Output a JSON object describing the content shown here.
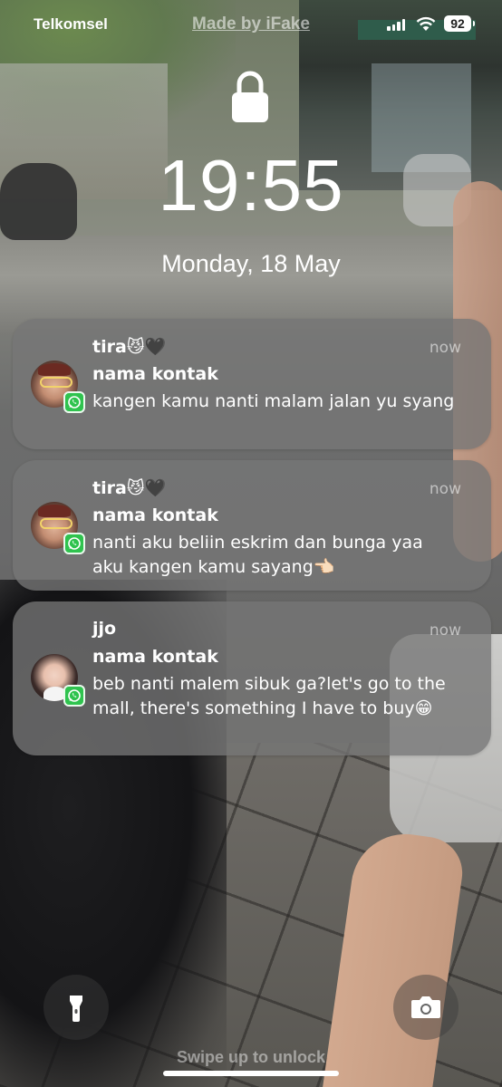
{
  "status_bar": {
    "carrier": "Telkomsel",
    "watermark": "Made by iFake",
    "battery": "92"
  },
  "lock_screen": {
    "time": "19:55",
    "date": "Monday, 18 May",
    "swipe_hint": "Swipe up to unlock"
  },
  "notifications": [
    {
      "sender": "tira",
      "sender_emoji": "😼🖤",
      "time": "now",
      "title": "nama kontak",
      "message": "kangen kamu nanti malam jalan yu syang",
      "app_icon": "whatsapp-icon"
    },
    {
      "sender": "tira",
      "sender_emoji": "😼🖤",
      "time": "now",
      "title": "nama kontak",
      "message": "nanti aku beliin eskrim dan bunga yaa aku kangen kamu sayang👈🏻",
      "app_icon": "whatsapp-icon"
    },
    {
      "sender": "jjo",
      "sender_emoji": "",
      "time": "now",
      "title": "nama kontak",
      "message": "beb nanti malem sibuk ga?let's go to the mall, there's something I have to buy😁",
      "app_icon": "whatsapp-icon"
    }
  ],
  "icons": {
    "lock": "lock-icon",
    "flashlight": "flashlight-icon",
    "camera": "camera-icon"
  },
  "colors": {
    "notification_bg": "#767676",
    "whatsapp_green": "#2fc34e"
  }
}
